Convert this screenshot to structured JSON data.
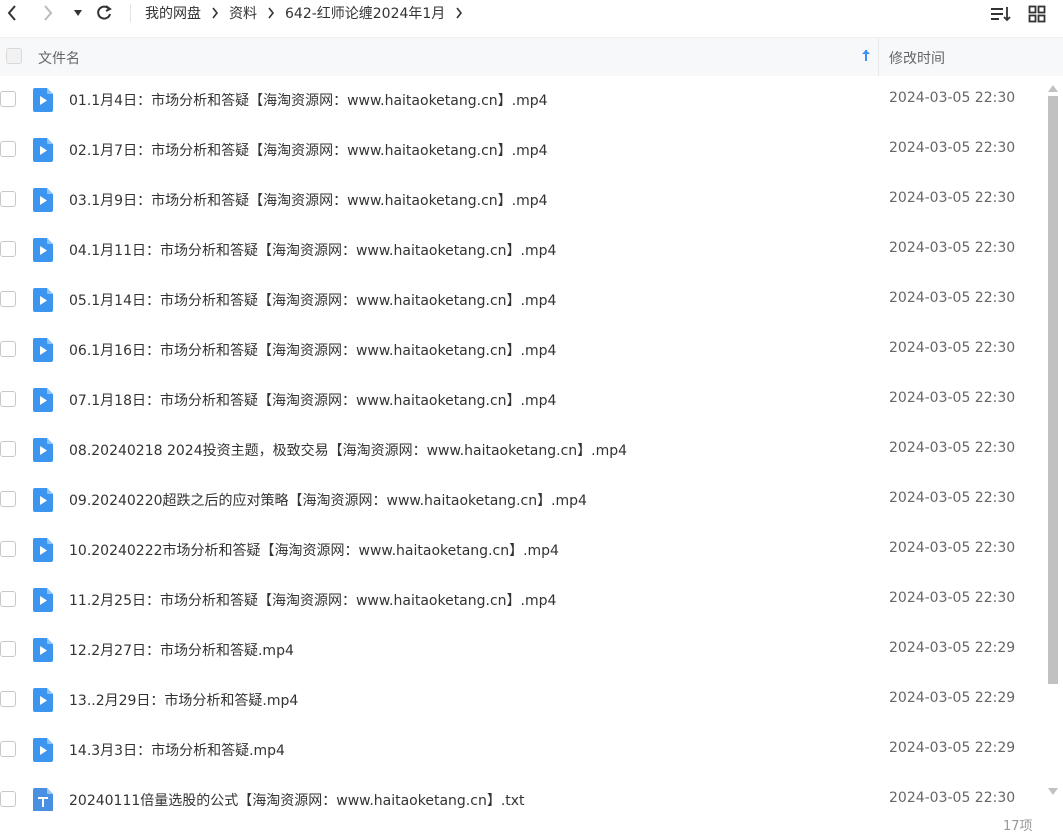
{
  "breadcrumb": [
    "我的网盘",
    "资料",
    "642-红师论缠2024年1月"
  ],
  "header": {
    "name_label": "文件名",
    "time_label": "修改时间"
  },
  "files": [
    {
      "name": "01.1月4日：市场分析和答疑【海淘资源网：www.haitaoketang.cn】.mp4",
      "time": "2024-03-05 22:30",
      "type": "video"
    },
    {
      "name": "02.1月7日：市场分析和答疑【海淘资源网：www.haitaoketang.cn】.mp4",
      "time": "2024-03-05 22:30",
      "type": "video"
    },
    {
      "name": "03.1月9日：市场分析和答疑【海淘资源网：www.haitaoketang.cn】.mp4",
      "time": "2024-03-05 22:30",
      "type": "video"
    },
    {
      "name": "04.1月11日：市场分析和答疑【海淘资源网：www.haitaoketang.cn】.mp4",
      "time": "2024-03-05 22:30",
      "type": "video"
    },
    {
      "name": "05.1月14日：市场分析和答疑【海淘资源网：www.haitaoketang.cn】.mp4",
      "time": "2024-03-05 22:30",
      "type": "video"
    },
    {
      "name": "06.1月16日：市场分析和答疑【海淘资源网：www.haitaoketang.cn】.mp4",
      "time": "2024-03-05 22:30",
      "type": "video"
    },
    {
      "name": "07.1月18日：市场分析和答疑【海淘资源网：www.haitaoketang.cn】.mp4",
      "time": "2024-03-05 22:30",
      "type": "video"
    },
    {
      "name": "08.20240218  2024投资主题，极致交易【海淘资源网：www.haitaoketang.cn】.mp4",
      "time": "2024-03-05 22:30",
      "type": "video"
    },
    {
      "name": "09.20240220超跌之后的应对策略【海淘资源网：www.haitaoketang.cn】.mp4",
      "time": "2024-03-05 22:30",
      "type": "video"
    },
    {
      "name": "10.20240222市场分析和答疑【海淘资源网：www.haitaoketang.cn】.mp4",
      "time": "2024-03-05 22:30",
      "type": "video"
    },
    {
      "name": "11.2月25日：市场分析和答疑【海淘资源网：www.haitaoketang.cn】.mp4",
      "time": "2024-03-05 22:30",
      "type": "video"
    },
    {
      "name": "12.2月27日：市场分析和答疑.mp4",
      "time": "2024-03-05 22:29",
      "type": "video"
    },
    {
      "name": "13..2月29日：市场分析和答疑.mp4",
      "time": "2024-03-05 22:29",
      "type": "video"
    },
    {
      "name": "14.3月3日：市场分析和答疑.mp4",
      "time": "2024-03-05 22:29",
      "type": "video"
    },
    {
      "name": "20240111倍量选股的公式【海淘资源网：www.haitaoketang.cn】.txt",
      "time": "2024-03-05 22:30",
      "type": "text"
    }
  ],
  "footer": {
    "count": "17项"
  },
  "icons": {
    "back": "chevron-left-icon",
    "forward": "chevron-right-icon",
    "dropdown": "caret-down-icon",
    "refresh": "refresh-icon",
    "sort": "sort-list-icon",
    "grid": "grid-view-icon",
    "video": "video-file-icon",
    "text": "text-file-icon",
    "sort_arrow": "arrow-up-icon"
  },
  "colors": {
    "accent": "#3b8ff5",
    "video_icon": "#3c96f0",
    "text_icon": "#4a90e2"
  }
}
